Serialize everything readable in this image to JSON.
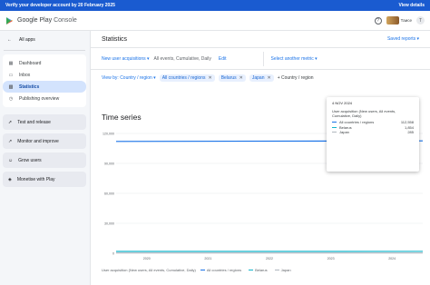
{
  "banner": {
    "message": "Verify your developer account by 20 February 2025",
    "action": "View details"
  },
  "header": {
    "product": "Google Play",
    "product_suffix": "Console",
    "account": "Таисе",
    "avatar_letter": "T"
  },
  "sidebar": {
    "back": "All apps",
    "items": [
      {
        "label": "Dashboard",
        "icon": "dashboard-icon"
      },
      {
        "label": "Inbox",
        "icon": "inbox-icon"
      },
      {
        "label": "Statistics",
        "icon": "bar-chart-icon",
        "active": true
      },
      {
        "label": "Publishing overview",
        "icon": "publish-icon"
      }
    ],
    "sections": [
      {
        "label": "Test and release",
        "icon": "rocket-icon"
      },
      {
        "label": "Monitor and improve",
        "icon": "trend-icon"
      },
      {
        "label": "Grow users",
        "icon": "users-icon"
      },
      {
        "label": "Monetise with Play",
        "icon": "tag-icon"
      }
    ]
  },
  "page": {
    "title": "Statistics",
    "saved_reports": "Saved reports"
  },
  "metric": {
    "name": "New user acquisitions",
    "details": "All events, Cumulative, Daily",
    "edit": "Edit",
    "second": "Select another metric"
  },
  "filters": {
    "view_by": "View by: Country / region",
    "chips": [
      "All countries / regions",
      "Belarus",
      "Japan"
    ],
    "add": "Country / region"
  },
  "time_series": {
    "title": "Time series"
  },
  "tooltip": {
    "date": "4 NOV 2024",
    "metric": "User acquisition (New users, All events, Cumulative, Daily)",
    "rows": [
      {
        "label": "All countries / regions",
        "value": "112,558",
        "color": "#1a73e8"
      },
      {
        "label": "Belarus",
        "value": "1,854",
        "color": "#12b5cb"
      },
      {
        "label": "Japan",
        "value": "285",
        "color": "#b0b7bf"
      }
    ]
  },
  "chart_data": {
    "type": "line",
    "ylim": [
      0,
      120000
    ],
    "yticks": [
      "0",
      "30,000",
      "60,000",
      "90,000",
      "120,000"
    ],
    "xticks": [
      "2020",
      "2021",
      "2022",
      "2023",
      "2024"
    ],
    "x_start": 2020.0,
    "x_end": 2025.0,
    "series": [
      {
        "name": "All countries / regions",
        "color": "#1a73e8",
        "x": [
          2020.0,
          2025.0
        ],
        "values": [
          112000,
          112558
        ]
      },
      {
        "name": "Belarus",
        "color": "#12b5cb",
        "x": [
          2020.0,
          2025.0
        ],
        "values": [
          1800,
          1854
        ]
      },
      {
        "name": "Japan",
        "color": "#b0b7bf",
        "x": [
          2020.0,
          2025.0
        ],
        "values": [
          280,
          285
        ]
      }
    ],
    "legend_label": "User acquisition (New users, All events, Cumulative, Daily)",
    "legend_position": "bottom-left",
    "grid": true
  }
}
